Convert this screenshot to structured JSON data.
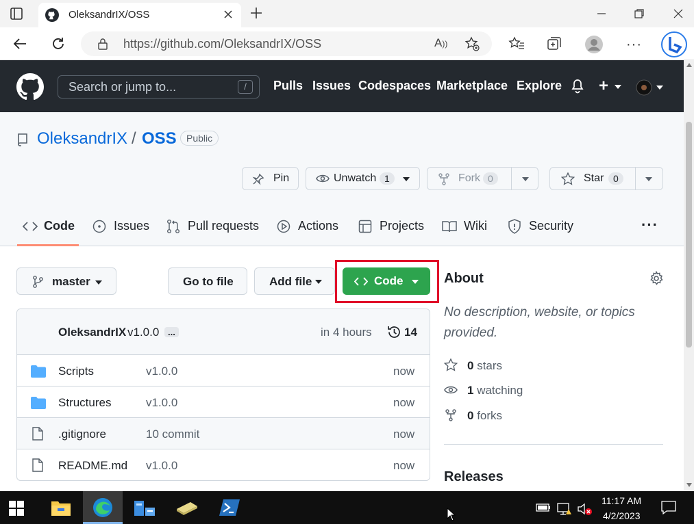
{
  "browser": {
    "tab_title": "OleksandrIX/OSS",
    "url": "https://github.com/OleksandrIX/OSS"
  },
  "header": {
    "search_placeholder": "Search or jump to...",
    "search_key": "/",
    "nav": [
      "Pulls",
      "Issues",
      "Codespaces",
      "Marketplace",
      "Explore"
    ],
    "plus": "+"
  },
  "repo": {
    "owner": "OleksandrIX",
    "sep": "/",
    "name": "OSS",
    "visibility": "Public",
    "pin": "Pin",
    "unwatch": "Unwatch",
    "watch_count": "1",
    "fork": "Fork",
    "fork_count": "0",
    "star": "Star",
    "star_count": "0"
  },
  "tabs": [
    "Code",
    "Issues",
    "Pull requests",
    "Actions",
    "Projects",
    "Wiki",
    "Security"
  ],
  "toolbar": {
    "branch": "master",
    "go_to_file": "Go to file",
    "add_file": "Add file",
    "code": "Code"
  },
  "commit": {
    "author": "OleksandrIX",
    "message": "v1.0.0",
    "ellipsis": "...",
    "time": "in 4 hours",
    "count": "14"
  },
  "files": [
    {
      "name": "Scripts",
      "msg": "v1.0.0",
      "time": "now",
      "type": "folder"
    },
    {
      "name": "Structures",
      "msg": "v1.0.0",
      "time": "now",
      "type": "folder"
    },
    {
      "name": ".gitignore",
      "msg": "10 commit",
      "time": "now",
      "type": "file"
    },
    {
      "name": "README.md",
      "msg": "v1.0.0",
      "time": "now",
      "type": "file"
    }
  ],
  "about": {
    "title": "About",
    "desc_line1": "No description, website, or topics",
    "desc_line2": "provided.",
    "stars_n": "0",
    "stars_label": "stars",
    "watch_n": "1",
    "watch_label": "watching",
    "forks_n": "0",
    "forks_label": "forks",
    "releases": "Releases"
  },
  "taskbar": {
    "time": "11:17 AM",
    "date": "4/2/2023"
  },
  "colors": {
    "accent_green": "#2da44e",
    "link_blue": "#0969da",
    "highlight_red": "#e0102a",
    "header_dark": "#24292f"
  }
}
